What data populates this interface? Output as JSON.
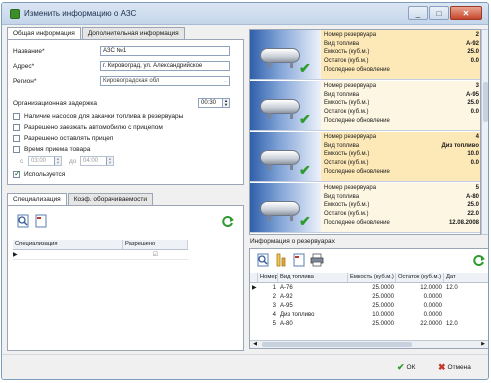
{
  "window": {
    "title": "Изменить информацию о АЗС"
  },
  "left_tabs": [
    "Общая информация",
    "Дополнительная информация"
  ],
  "form": {
    "name_label": "Название*",
    "name_value": "АЗС №1",
    "address_label": "Адрес*",
    "address_value": "г. Кировоград, ул. Александрийское",
    "region_label": "Регион*",
    "region_value": "Кировоградская обл",
    "delay_label": "Организационная задержка",
    "delay_value": "00:30"
  },
  "checkboxes": [
    {
      "label": "Наличие насосов для закачки топлива в резервуары",
      "checked": false
    },
    {
      "label": "Разрешено заезжать автомобилю с прицепом",
      "checked": false
    },
    {
      "label": "Разрешено оставлять прицеп",
      "checked": false
    },
    {
      "label": "Время приема товара",
      "checked": false
    },
    {
      "label": "Используется",
      "checked": true
    }
  ],
  "time_range": {
    "from_label": "с",
    "from_value": "03:00",
    "to_label": "до",
    "to_value": "04:00"
  },
  "bottom_tabs": [
    "Специализация",
    "Коэф. оборачиваемости"
  ],
  "spec_grid": {
    "headers": [
      "Специализация",
      "Разрешено"
    ]
  },
  "tank_fields": [
    "Номер резервуара",
    "Вид топлива",
    "Емкость (куб.м.)",
    "Остаток (куб.м.)",
    "Последнее обновление"
  ],
  "tanks": [
    {
      "number": "2",
      "fuel": "А-92",
      "capacity": "25.0",
      "rest": "0.0",
      "updated": "",
      "highlight": "yellow"
    },
    {
      "number": "3",
      "fuel": "А-95",
      "capacity": "25.0",
      "rest": "0.0",
      "updated": "",
      "highlight": "white"
    },
    {
      "number": "4",
      "fuel": "Диз топливо",
      "capacity": "10.0",
      "rest": "0.0",
      "updated": "",
      "highlight": "yellow"
    },
    {
      "number": "5",
      "fuel": "А-80",
      "capacity": "25.0",
      "rest": "22.0",
      "updated": "12.08.2008",
      "highlight": "white"
    }
  ],
  "reservoir_info": {
    "title": "Информация о резервуарах",
    "headers": [
      "Номер",
      "Вид топлива",
      "Емкость (куб.м.)",
      "Остаток (куб.м.)",
      "Дат"
    ],
    "rows": [
      {
        "num": "1",
        "fuel": "А-76",
        "cap": "25.0000",
        "rest": "12.0000",
        "date": "12.0"
      },
      {
        "num": "2",
        "fuel": "А-92",
        "cap": "25.0000",
        "rest": "0.0000",
        "date": ""
      },
      {
        "num": "3",
        "fuel": "А-95",
        "cap": "25.0000",
        "rest": "0.0000",
        "date": ""
      },
      {
        "num": "4",
        "fuel": "Диз топливо",
        "cap": "10.0000",
        "rest": "0.0000",
        "date": ""
      },
      {
        "num": "5",
        "fuel": "А-80",
        "cap": "25.0000",
        "rest": "22.0000",
        "date": "12.0"
      }
    ]
  },
  "footer": {
    "ok_label": "ОК",
    "cancel_label": "Отмена"
  }
}
